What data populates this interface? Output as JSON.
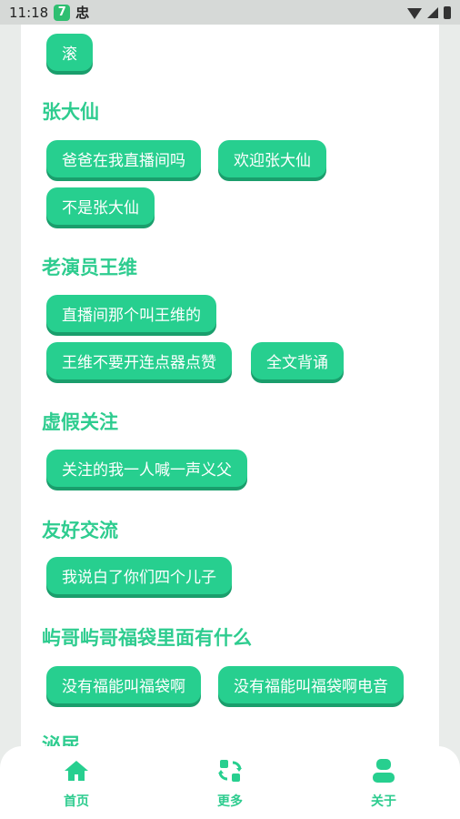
{
  "status_bar": {
    "time": "11:18",
    "app_badge": "7",
    "glyph": "忠"
  },
  "sections": [
    {
      "title": "",
      "chips": [
        "滚"
      ]
    },
    {
      "title": "张大仙",
      "chips": [
        "爸爸在我直播间吗",
        "欢迎张大仙",
        "不是张大仙"
      ]
    },
    {
      "title": "老演员王维",
      "chips": [
        "直播间那个叫王维的",
        "王维不要开连点器点赞",
        "全文背诵"
      ]
    },
    {
      "title": "虚假关注",
      "chips": [
        "关注的我一人喊一声义父"
      ]
    },
    {
      "title": "友好交流",
      "chips": [
        "我说白了你们四个儿子"
      ]
    },
    {
      "title": "屿哥屿哥福袋里面有什么",
      "chips": [
        "没有福能叫福袋啊",
        "没有福能叫福袋啊电音"
      ]
    },
    {
      "title": "泌尿",
      "chips": []
    }
  ],
  "bottom_nav": {
    "items": [
      {
        "label": "首页",
        "icon": "home-icon"
      },
      {
        "label": "更多",
        "icon": "more-icon"
      },
      {
        "label": "关于",
        "icon": "user-icon"
      }
    ]
  },
  "colors": {
    "accent": "#27cf8f",
    "accent_shadow": "#1a9e6c",
    "title": "#2ecc8f"
  }
}
